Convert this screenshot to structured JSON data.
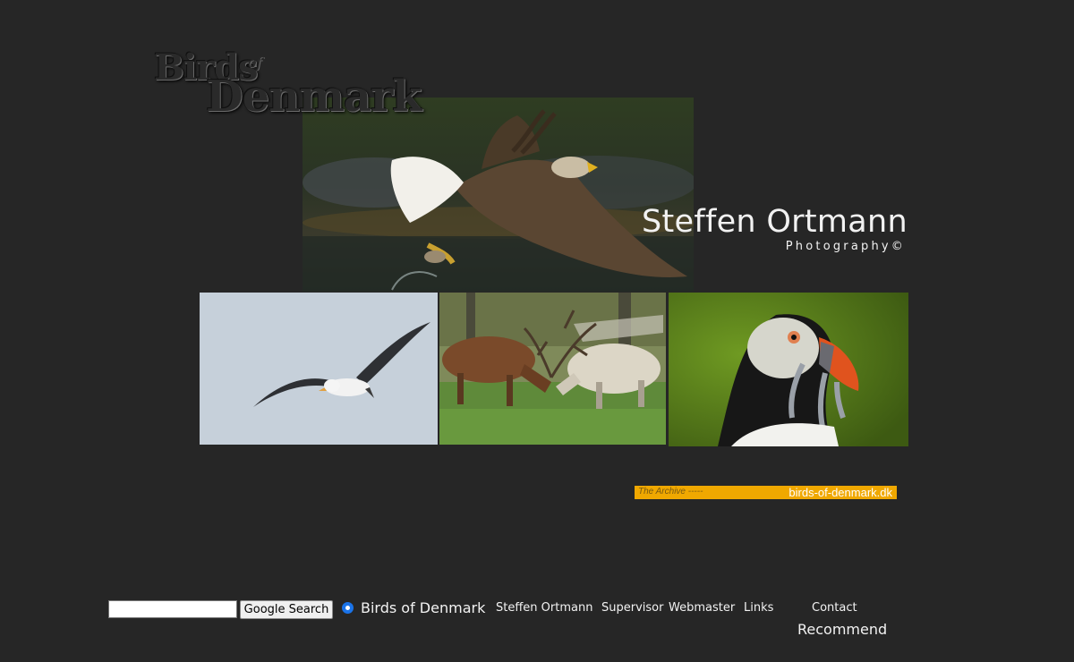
{
  "logo": {
    "line1": "Birds",
    "of": "of",
    "line2": "Denmark"
  },
  "header": {
    "name": "Steffen Ortmann",
    "subtitle": "Photography©"
  },
  "photos": [
    {
      "subject": "white-tailed eagle"
    },
    {
      "subject": "albatross"
    },
    {
      "subject": "red deer"
    },
    {
      "subject": "puffin"
    }
  ],
  "archive": {
    "left_text": "The Archive -----",
    "right_text": "birds-of-denmark.dk",
    "color": "#f0a800"
  },
  "search": {
    "input_value": "",
    "button_label": "Google Search",
    "radio_label": "Birds of Denmark",
    "radio_color": "#1a73e8"
  },
  "nav": {
    "items": [
      {
        "label": "Steffen Ortmann"
      },
      {
        "label": "Supervisor"
      },
      {
        "label": "Webmaster"
      },
      {
        "label": "Links"
      },
      {
        "label": "Contact"
      }
    ],
    "recommend": "Recommend"
  },
  "colors": {
    "background": "#262626",
    "text": "#f2f2f2"
  }
}
